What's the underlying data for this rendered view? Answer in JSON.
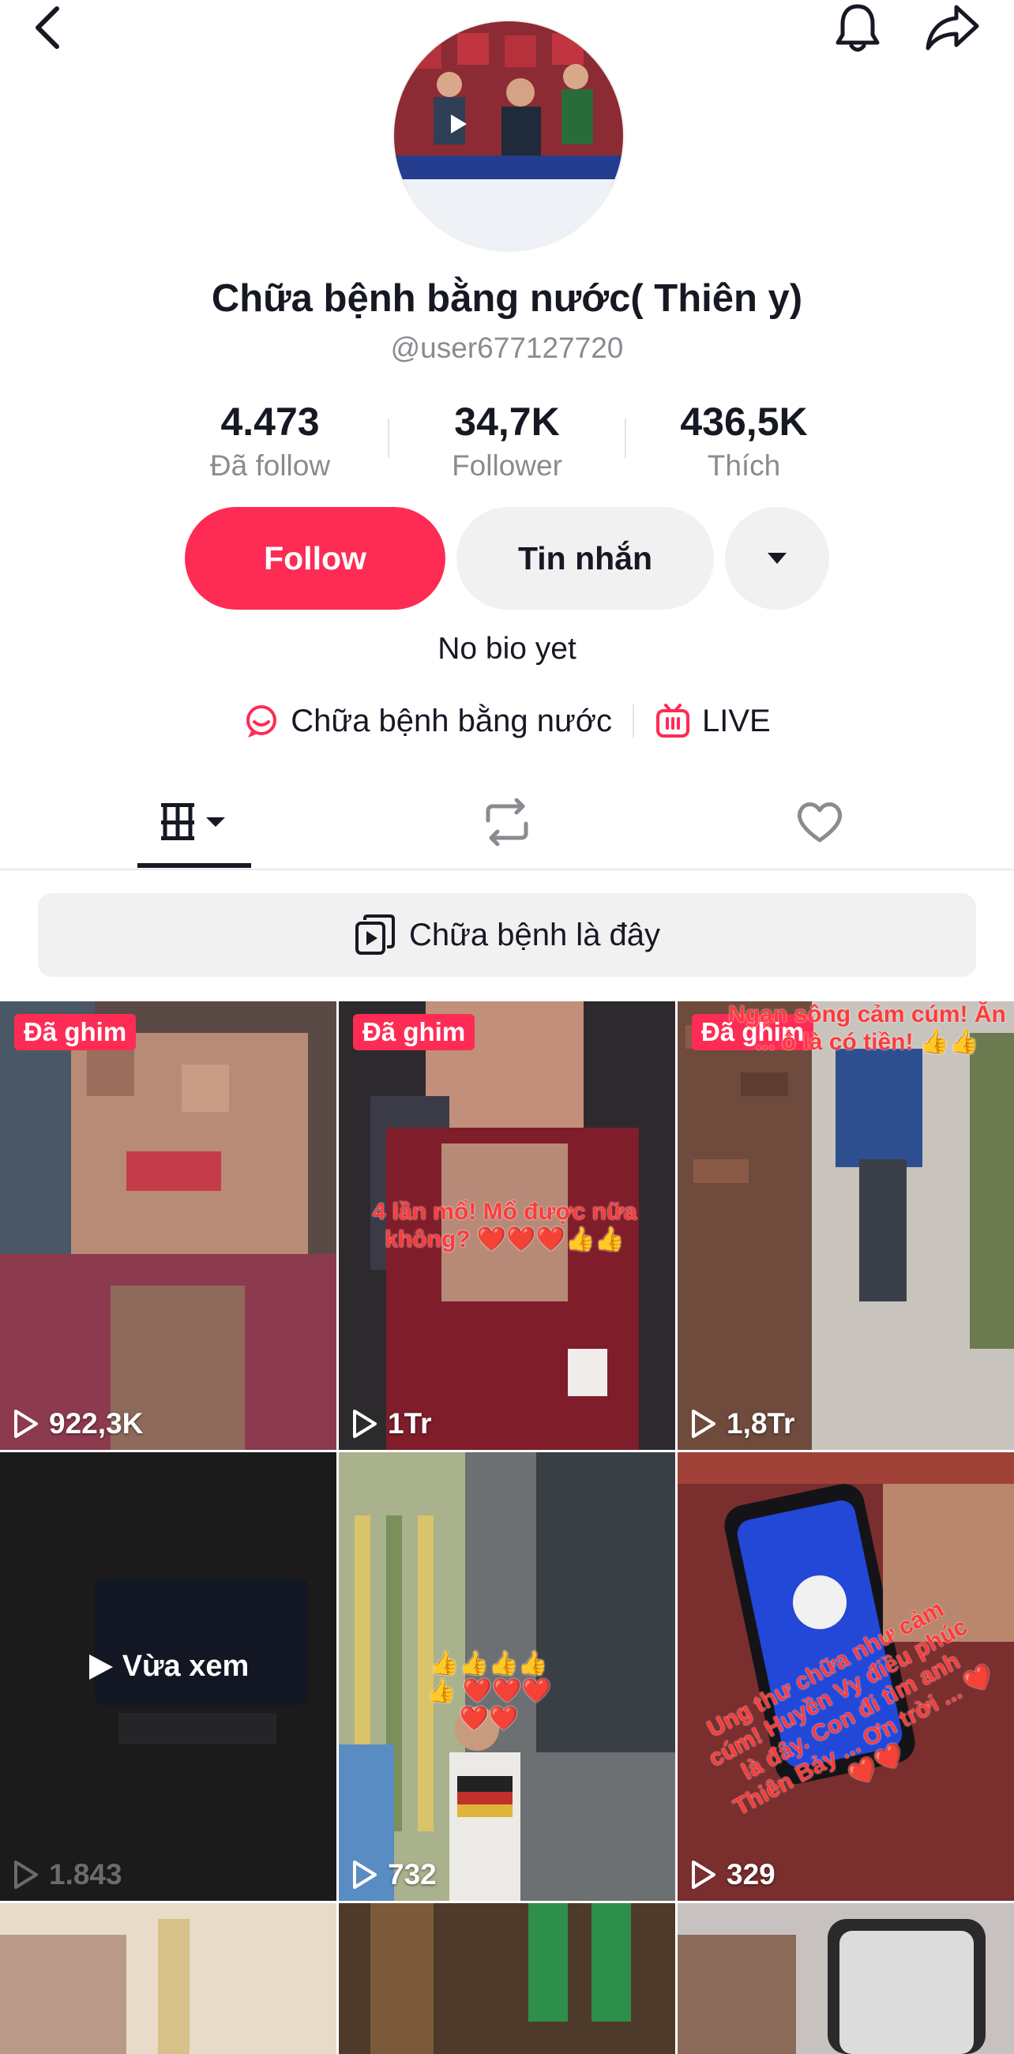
{
  "profile": {
    "display_name": "Chữa bệnh bằng nước( Thiên y)",
    "username": "@user677127720",
    "bio": "No bio yet"
  },
  "stats": [
    {
      "value": "4.473",
      "label": "Đã follow"
    },
    {
      "value": "34,7K",
      "label": "Follower"
    },
    {
      "value": "436,5K",
      "label": "Thích"
    }
  ],
  "actions": {
    "follow_label": "Follow",
    "message_label": "Tin nhắn"
  },
  "links": {
    "channel_label": "Chữa bệnh bằng nước",
    "live_label": "LIVE"
  },
  "playlist": {
    "label": "Chữa bệnh là đây"
  },
  "videos": [
    {
      "pinned": "Đã ghim",
      "views": "922,3K",
      "caption": ""
    },
    {
      "pinned": "Đã ghim",
      "views": "1Tr",
      "caption": "4 lần mổ! Mổ được nữa không? ❤️❤️❤️👍👍"
    },
    {
      "pinned": "Đã ghim",
      "views": "1,8Tr",
      "caption": "Ngạn sông cảm cúm! Ăn ... ô là có tiền! 👍👍"
    },
    {
      "watched": "Vừa xem",
      "views": "1.843",
      "caption": ""
    },
    {
      "views": "732",
      "caption": "👍👍👍👍👍 ❤️❤️❤️❤️❤️"
    },
    {
      "views": "329",
      "caption": "Ung thư chữa như cảm cúm! Huyền Vy điều phúc là đây. Con đi tìm anh Thiên Bảy ... Ơn trời ... ❤️❤️❤️"
    }
  ],
  "colors": {
    "accent": "#fe2c55",
    "text_primary": "#161823",
    "text_secondary": "#8a8b91",
    "surface": "#f1f1f2"
  }
}
